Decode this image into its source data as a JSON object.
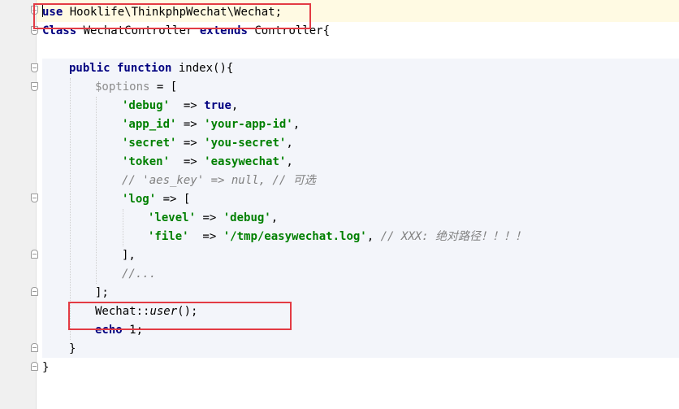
{
  "code": {
    "line1": {
      "kw": "use",
      "rest": " Hooklife\\ThinkphpWechat\\Wechat;"
    },
    "line2": {
      "kw1": "Class",
      "name": " WechatController ",
      "kw2": "extends",
      "rest": " Controller{"
    },
    "line4": {
      "kw1": "public",
      "kw2": " function",
      "rest": " index(){"
    },
    "line5": {
      "var": "$options",
      "rest": " = ["
    },
    "line6": {
      "key": "'debug'",
      "arrow": "  => ",
      "val": "true",
      "end": ","
    },
    "line7": {
      "key": "'app_id'",
      "arrow": " => ",
      "val": "'your-app-id'",
      "end": ","
    },
    "line8": {
      "key": "'secret'",
      "arrow": " => ",
      "val": "'you-secret'",
      "end": ","
    },
    "line9": {
      "key": "'token'",
      "arrow": "  => ",
      "val": "'easywechat'",
      "end": ","
    },
    "line10": {
      "comment": "// 'aes_key' => null, // 可选"
    },
    "line11": {
      "key": "'log'",
      "rest": " => ["
    },
    "line12": {
      "key": "'level'",
      "arrow": " => ",
      "val": "'debug'",
      "end": ","
    },
    "line13": {
      "key": "'file'",
      "arrow": "  => ",
      "val": "'/tmp/easywechat.log'",
      "end": ", ",
      "comment": "// XXX: 绝对路径！！！！"
    },
    "line14": {
      "text": "],"
    },
    "line15": {
      "comment": "//..."
    },
    "line16": {
      "text": "];"
    },
    "line17": {
      "cls": "Wechat::",
      "method": "user",
      "end": "();"
    },
    "line18": {
      "kw": "echo",
      "rest": " 1;"
    },
    "line19": {
      "text": "}"
    },
    "line20": {
      "text": "}"
    }
  },
  "colors": {
    "keyword": "#000080",
    "string": "#008000",
    "comment": "#808080",
    "highlight_box": "#e33b44",
    "method_background": "#f3f5fa",
    "caret_line": "#fffae3"
  }
}
